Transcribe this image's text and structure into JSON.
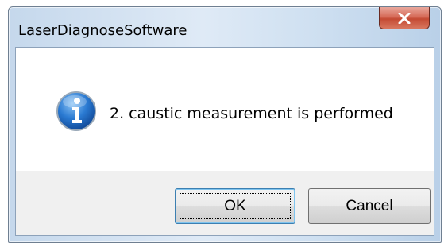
{
  "dialog": {
    "title": "LaserDiagnoseSoftware",
    "message": "2. caustic measurement is performed",
    "icon": "info-icon",
    "buttons": {
      "ok_label": "OK",
      "cancel_label": "Cancel"
    }
  },
  "colors": {
    "close_button": "#c44a33",
    "info_icon": "#1f6fc6",
    "client_background": "#f0f0f0"
  }
}
